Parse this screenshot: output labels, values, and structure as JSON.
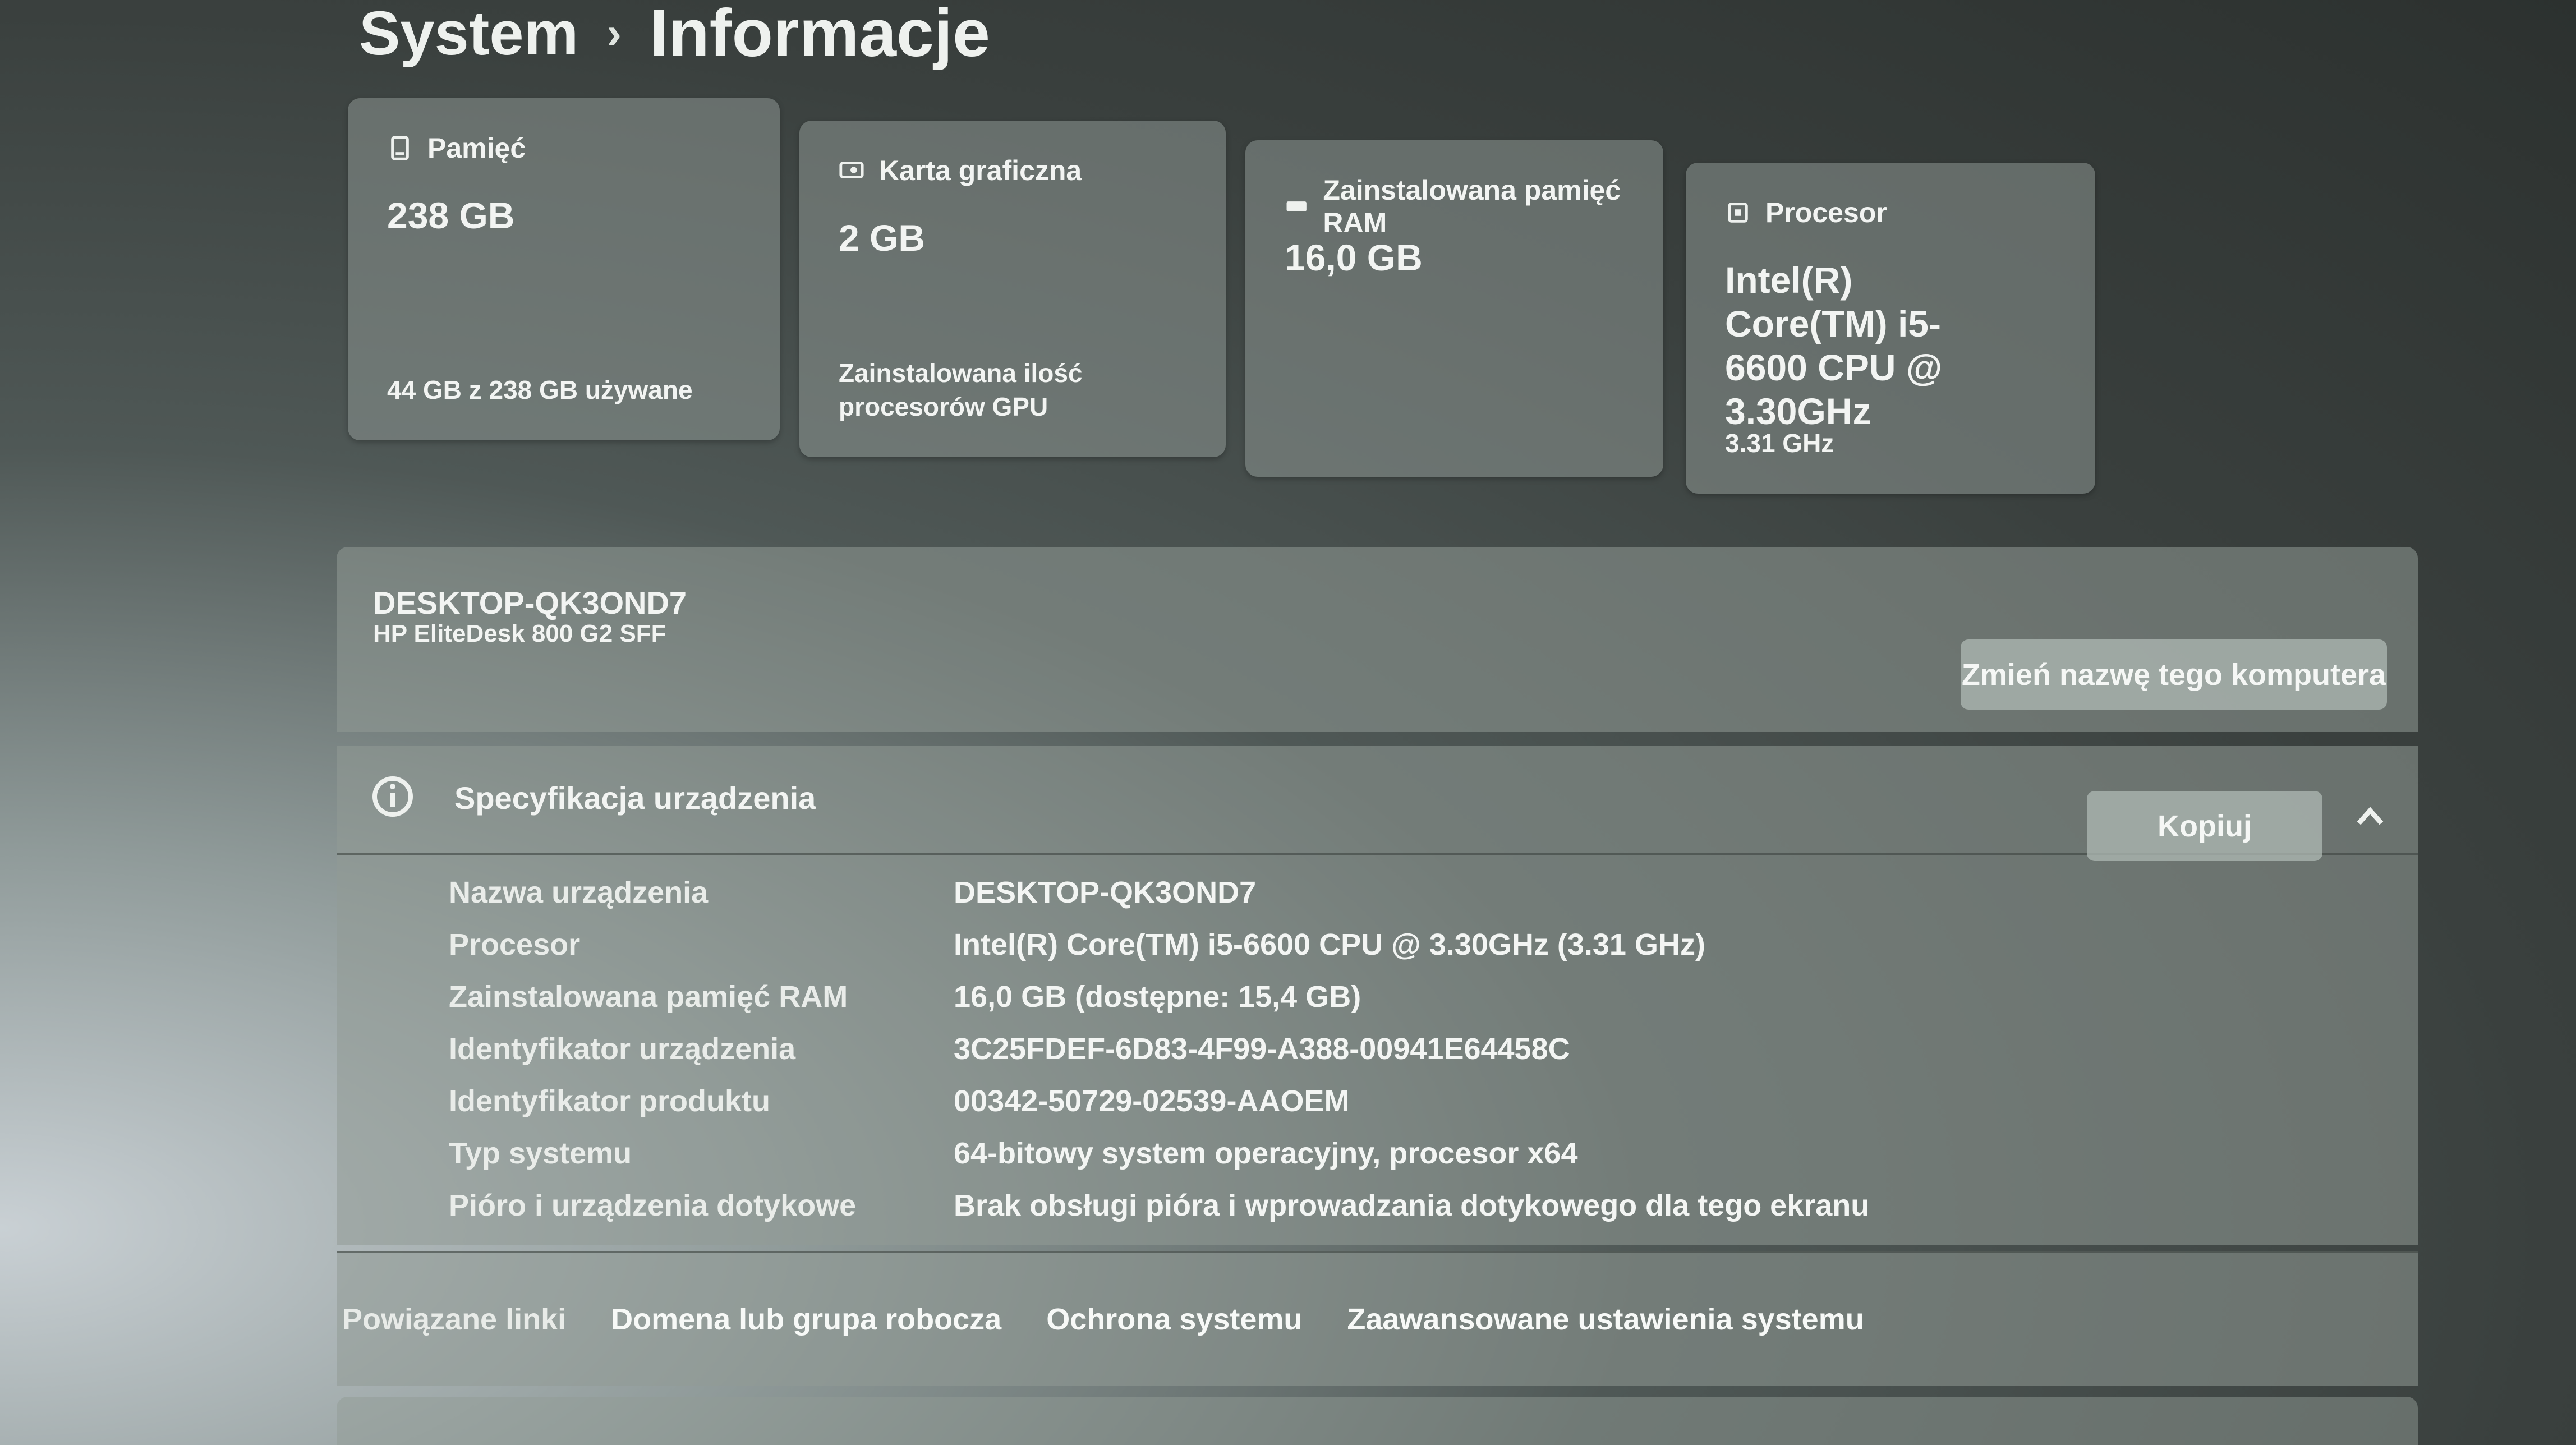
{
  "breadcrumb": {
    "parent": "System",
    "separator": "›",
    "current": "Informacje"
  },
  "cards": [
    {
      "icon": "storage-icon",
      "label": "Pamięć",
      "value": "238 GB",
      "footer": "44 GB z 238 GB używane"
    },
    {
      "icon": "gpu-card-icon",
      "label": "Karta graficzna",
      "value": "2 GB",
      "footer": "Zainstalowana ilość procesorów GPU"
    },
    {
      "icon": "ram-icon",
      "label": "Zainstalowana pamięć RAM",
      "value": "16,0 GB",
      "footer": ""
    },
    {
      "icon": "processor-icon",
      "label": "Procesor",
      "value": "Intel(R) Core(TM) i5-6600 CPU @ 3.30GHz",
      "footer": "3.31 GHz"
    }
  ],
  "device": {
    "name": "DESKTOP-QK3OND7",
    "model": "HP EliteDesk 800 G2 SFF",
    "rename_label": "Zmień nazwę tego komputera"
  },
  "spec": {
    "title": "Specyfikacja urządzenia",
    "copy_label": "Kopiuj",
    "rows": [
      {
        "key": "Nazwa urządzenia",
        "value": "DESKTOP-QK3OND7"
      },
      {
        "key": "Procesor",
        "value": "Intel(R) Core(TM) i5-6600 CPU @ 3.30GHz (3.31 GHz)"
      },
      {
        "key": "Zainstalowana pamięć RAM",
        "value": "16,0 GB (dostępne: 15,4 GB)"
      },
      {
        "key": "Identyfikator urządzenia",
        "value": "3C25FDEF-6D83-4F99-A388-00941E64458C"
      },
      {
        "key": "Identyfikator produktu",
        "value": "00342-50729-02539-AAOEM"
      },
      {
        "key": "Typ systemu",
        "value": "64-bitowy system operacyjny, procesor x64"
      },
      {
        "key": "Pióro i urządzenia dotykowe",
        "value": "Brak obsługi pióra i wprowadzania dotykowego dla tego ekranu"
      }
    ]
  },
  "links": {
    "label": "Powiązane linki",
    "items": [
      "Domena lub grupa robocza",
      "Ochrona systemu",
      "Zaawansowane ustawienia systemu"
    ]
  }
}
